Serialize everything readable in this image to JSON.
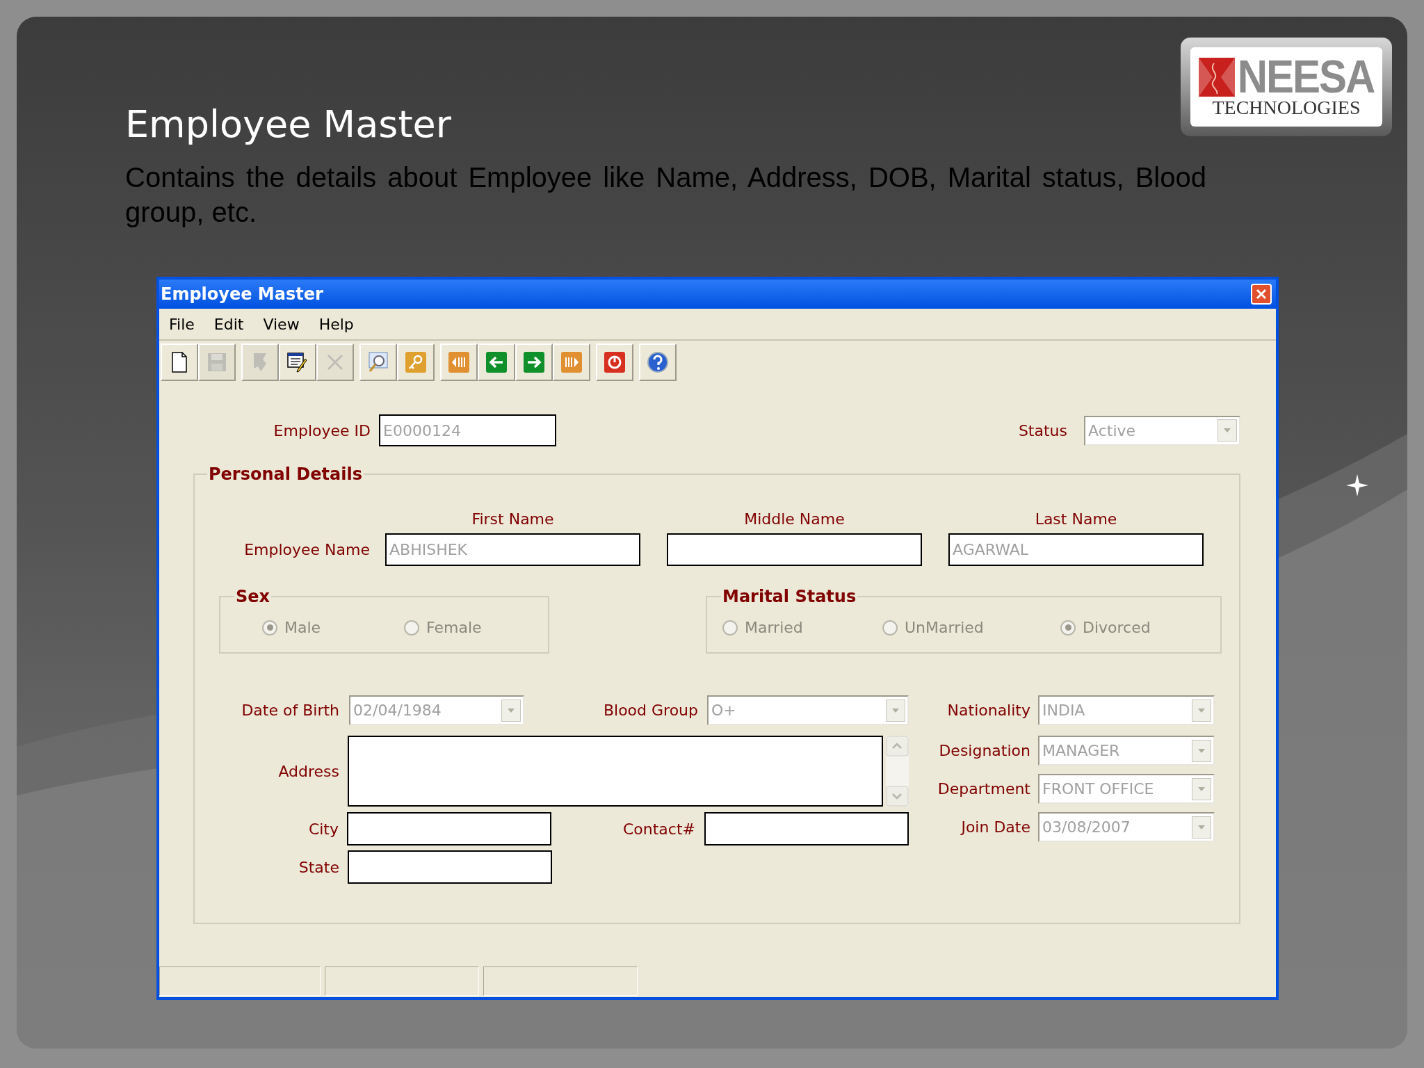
{
  "slide": {
    "title": "Employee Master",
    "description": "Contains the details about Employee like Name, Address, DOB, Marital status, Blood group, etc.",
    "logo": {
      "name": "NEESA",
      "tagline": "TECHNOLOGIES"
    }
  },
  "window": {
    "title": "Employee Master",
    "menu": [
      "File",
      "Edit",
      "View",
      "Help"
    ],
    "toolbar": [
      [
        {
          "kind": "new",
          "disabled": false
        },
        {
          "kind": "save",
          "disabled": true
        }
      ],
      [
        {
          "kind": "undo",
          "disabled": true
        },
        {
          "kind": "edit",
          "disabled": false
        },
        {
          "kind": "delete",
          "disabled": true
        }
      ],
      [
        {
          "kind": "search",
          "disabled": false
        },
        {
          "kind": "key",
          "disabled": false
        }
      ],
      [
        {
          "kind": "first",
          "disabled": false
        },
        {
          "kind": "prev",
          "disabled": false
        },
        {
          "kind": "next",
          "disabled": false
        },
        {
          "kind": "last",
          "disabled": false
        }
      ],
      [
        {
          "kind": "exit",
          "disabled": false
        }
      ],
      [
        {
          "kind": "help",
          "disabled": false
        }
      ]
    ],
    "employee_id": {
      "label": "Employee ID",
      "value": "E0000124"
    },
    "status": {
      "label": "Status",
      "value": "Active"
    },
    "personal_details": {
      "title": "Personal Details",
      "name_label": "Employee Name",
      "name_fields": [
        {
          "header": "First Name",
          "value": "ABHISHEK"
        },
        {
          "header": "Middle Name"
        },
        {
          "header": "Last Name",
          "value": "AGARWAL"
        }
      ],
      "sex": {
        "title": "Sex",
        "options": [
          {
            "label": "Male",
            "selected": true
          },
          {
            "label": "Female",
            "selected": false
          }
        ]
      },
      "marital_status": {
        "title": "Marital Status",
        "options": [
          {
            "label": "Married",
            "selected": false
          },
          {
            "label": "UnMarried",
            "selected": false
          },
          {
            "label": "Divorced",
            "selected": true
          }
        ]
      },
      "date_of_birth": {
        "label": "Date of Birth",
        "value": "02/04/1984"
      },
      "blood_group": {
        "label": "Blood Group",
        "value": "O+"
      },
      "address": {
        "label": "Address"
      },
      "city": {
        "label": "City"
      },
      "contact": {
        "label": "Contact#"
      },
      "state": {
        "label": "State"
      },
      "nationality": {
        "label": "Nationality",
        "value": "INDIA"
      },
      "designation": {
        "label": "Designation",
        "value": "MANAGER"
      },
      "department": {
        "label": "Department",
        "value": "FRONT OFFICE"
      },
      "join_date": {
        "label": "Join Date",
        "value": "03/08/2007"
      }
    }
  }
}
